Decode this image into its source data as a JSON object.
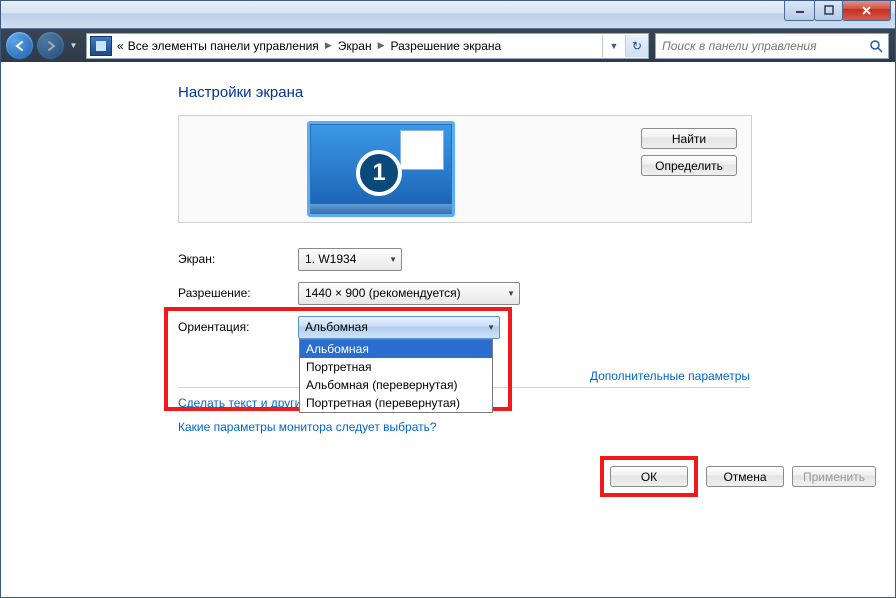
{
  "titlebar": {},
  "nav": {
    "breadcrumb_prefix": "«",
    "breadcrumb": [
      "Все элементы панели управления",
      "Экран",
      "Разрешение экрана"
    ],
    "search_placeholder": "Поиск в панели управления"
  },
  "page": {
    "title": "Настройки экрана",
    "monitor_number": "1",
    "find_button": "Найти",
    "identify_button": "Определить"
  },
  "form": {
    "display_label": "Экран:",
    "display_value": "1. W1934",
    "resolution_label": "Разрешение:",
    "resolution_value": "1440 × 900 (рекомендуется)",
    "orientation_label": "Ориентация:",
    "orientation_value": "Альбомная",
    "orientation_options": [
      "Альбомная",
      "Портретная",
      "Альбомная (перевернутая)",
      "Портретная (перевернутая)"
    ]
  },
  "links": {
    "advanced": "Дополнительные параметры",
    "text_link": "Сделать текст и другие",
    "help_link": "Какие параметры монитора следует выбрать?"
  },
  "buttons": {
    "ok": "ОК",
    "cancel": "Отмена",
    "apply": "Применить"
  }
}
